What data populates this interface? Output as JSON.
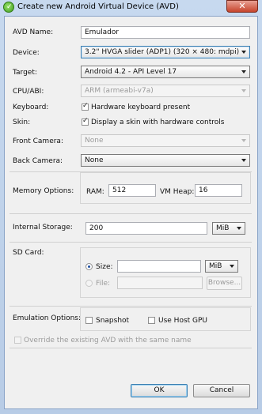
{
  "window": {
    "title": "Create new Android Virtual Device (AVD)",
    "close_symbol": "✕"
  },
  "form": {
    "avd_name": {
      "label": "AVD Name:",
      "value": "Emulador"
    },
    "device": {
      "label": "Device:",
      "value": "3.2\" HVGA slider (ADP1) (320 × 480: mdpi)"
    },
    "target": {
      "label": "Target:",
      "value": "Android 4.2 - API Level 17"
    },
    "cpu_abi": {
      "label": "CPU/ABI:",
      "value": "ARM (armeabi-v7a)"
    },
    "keyboard": {
      "label": "Keyboard:",
      "checkbox_label": "Hardware keyboard present",
      "checked": true
    },
    "skin": {
      "label": "Skin:",
      "checkbox_label": "Display a skin with hardware controls",
      "checked": true
    },
    "front_camera": {
      "label": "Front Camera:",
      "value": "None"
    },
    "back_camera": {
      "label": "Back Camera:",
      "value": "None"
    },
    "memory": {
      "label": "Memory Options:",
      "ram_label": "RAM:",
      "ram_value": "512",
      "vm_heap_label": "VM Heap:",
      "vm_heap_value": "16"
    },
    "internal_storage": {
      "label": "Internal Storage:",
      "value": "200",
      "unit": "MiB"
    },
    "sd_card": {
      "label": "SD Card:",
      "size_label": "Size:",
      "size_value": "",
      "size_unit": "MiB",
      "file_label": "File:",
      "file_value": "",
      "browse_label": "Browse..."
    },
    "emulation": {
      "label": "Emulation Options:",
      "snapshot_label": "Snapshot",
      "gpu_label": "Use Host GPU"
    },
    "override": {
      "label": "Override the existing AVD with the same name"
    }
  },
  "buttons": {
    "ok": "OK",
    "cancel": "Cancel"
  }
}
